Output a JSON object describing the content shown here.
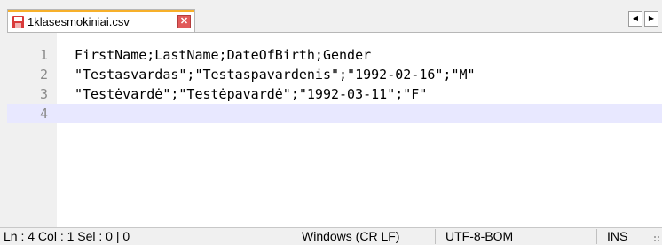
{
  "tab": {
    "filename": "1klasesmokiniai.csv",
    "close_symbol": "✕",
    "icon": "save-file-icon",
    "accent_color": "#f7b02a"
  },
  "tab_scroll": {
    "left_symbol": "◀",
    "right_symbol": "▶"
  },
  "editor": {
    "lines": [
      {
        "num": "1",
        "text": "FirstName;LastName;DateOfBirth;Gender"
      },
      {
        "num": "2",
        "text": "\"Testasvardas\";\"Testaspavardenis\";\"1992-02-16\";\"M\""
      },
      {
        "num": "3",
        "text": "\"Testėvardė\";\"Testėpavardė\";\"1992-03-11\";\"F\""
      },
      {
        "num": "4",
        "text": ""
      }
    ],
    "current_line_color": "#e8e8ff"
  },
  "status": {
    "position": "Ln : 4    Col : 1    Sel : 0 | 0",
    "eol": "Windows (CR LF)",
    "encoding": "UTF-8-BOM",
    "mode": "INS"
  }
}
